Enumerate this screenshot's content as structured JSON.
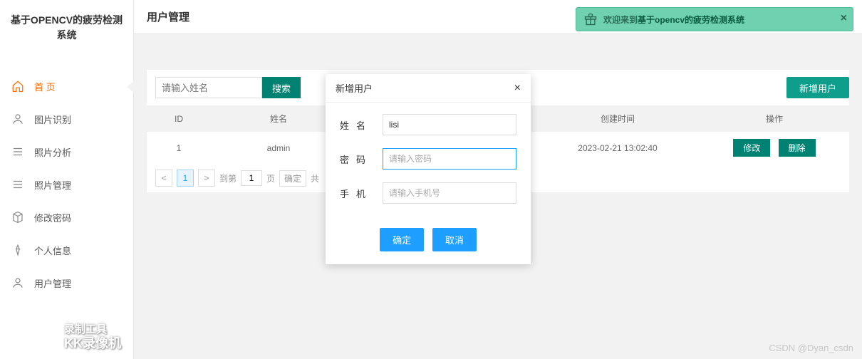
{
  "app": {
    "title": "基于OPENCV的疲劳检测系统"
  },
  "nav": {
    "items": [
      {
        "label": "首 页",
        "icon": "home"
      },
      {
        "label": "图片识别",
        "icon": "user"
      },
      {
        "label": "照片分析",
        "icon": "list"
      },
      {
        "label": "照片管理",
        "icon": "list"
      },
      {
        "label": "修改密码",
        "icon": "cube"
      },
      {
        "label": "个人信息",
        "icon": "pen"
      },
      {
        "label": "用户管理",
        "icon": "user"
      }
    ]
  },
  "header": {
    "title": "用户管理"
  },
  "banner": {
    "prefix": "欢迎来到",
    "bold": "基于opencv的疲劳检测系统"
  },
  "search": {
    "placeholder": "请输入姓名",
    "button": "搜索"
  },
  "add_btn": "新增用户",
  "table": {
    "headers": {
      "id": "ID",
      "name": "姓名",
      "created": "创建时间",
      "ops": "操作"
    },
    "row": {
      "id": "1",
      "name": "admin",
      "created": "2023-02-21 13:02:40"
    },
    "ops": {
      "edit": "修改",
      "del": "删除"
    }
  },
  "pager": {
    "to_prefix": "到第",
    "page_val": "1",
    "page_suffix": "页",
    "confirm": "确定",
    "total_prefix": "共",
    "cur": "1"
  },
  "modal": {
    "title": "新增用户",
    "labels": {
      "name": "姓名",
      "pwd": "密码",
      "phone": "手机"
    },
    "name_value": "lisi",
    "pwd_placeholder": "请输入密码",
    "phone_placeholder": "请输入手机号",
    "ok": "确定",
    "cancel": "取消"
  },
  "watermark": {
    "line1": "录制工具",
    "line2": "KK录像机"
  },
  "csdn": "CSDN @Dyan_csdn"
}
